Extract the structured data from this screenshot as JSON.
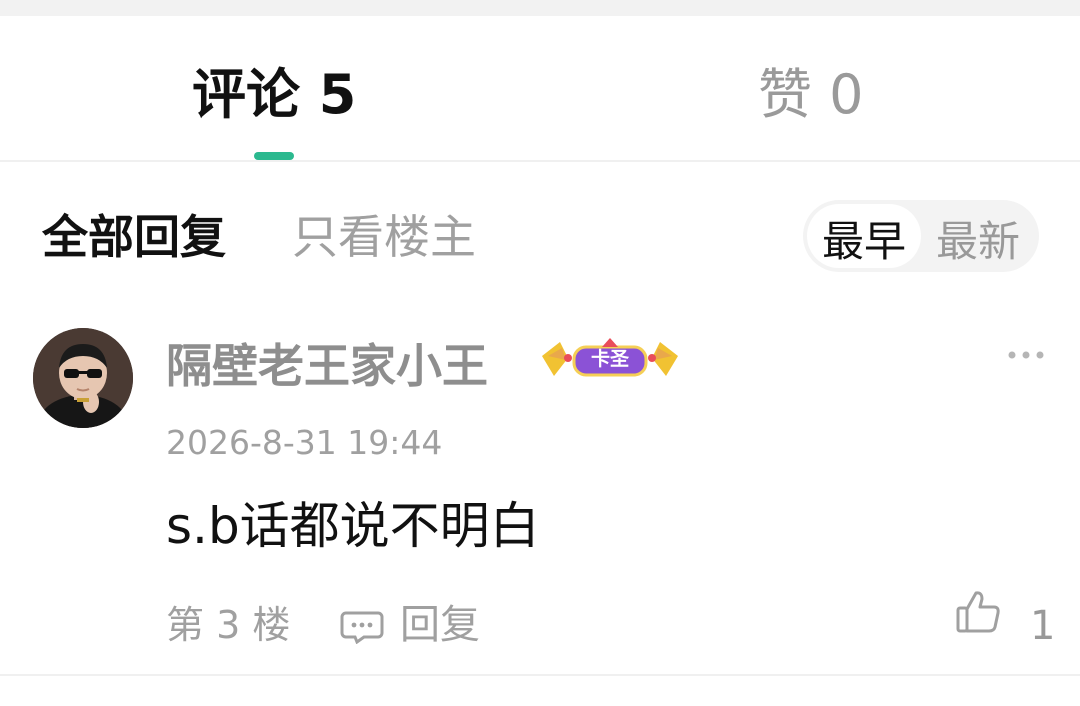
{
  "tabs": {
    "comments_label": "评论 5",
    "likes_label": "赞 0",
    "active_color": "#2bb98f"
  },
  "filters": {
    "all_replies": "全部回复",
    "op_only": "只看楼主"
  },
  "sort": {
    "earliest": "最早",
    "newest": "最新",
    "selected": "最早"
  },
  "comment": {
    "username": "隔壁老王家小王",
    "badge": "卡圣",
    "timestamp": "2026-8-31 19:44",
    "text": "s.b话都说不明白",
    "floor": "第 3 楼",
    "reply_label": "回复",
    "like_count": "1"
  },
  "icons": {
    "more": "more-dots-icon",
    "reply": "comment-bubble-icon",
    "like": "thumbs-up-icon",
    "badge": "crown-badge-icon"
  }
}
